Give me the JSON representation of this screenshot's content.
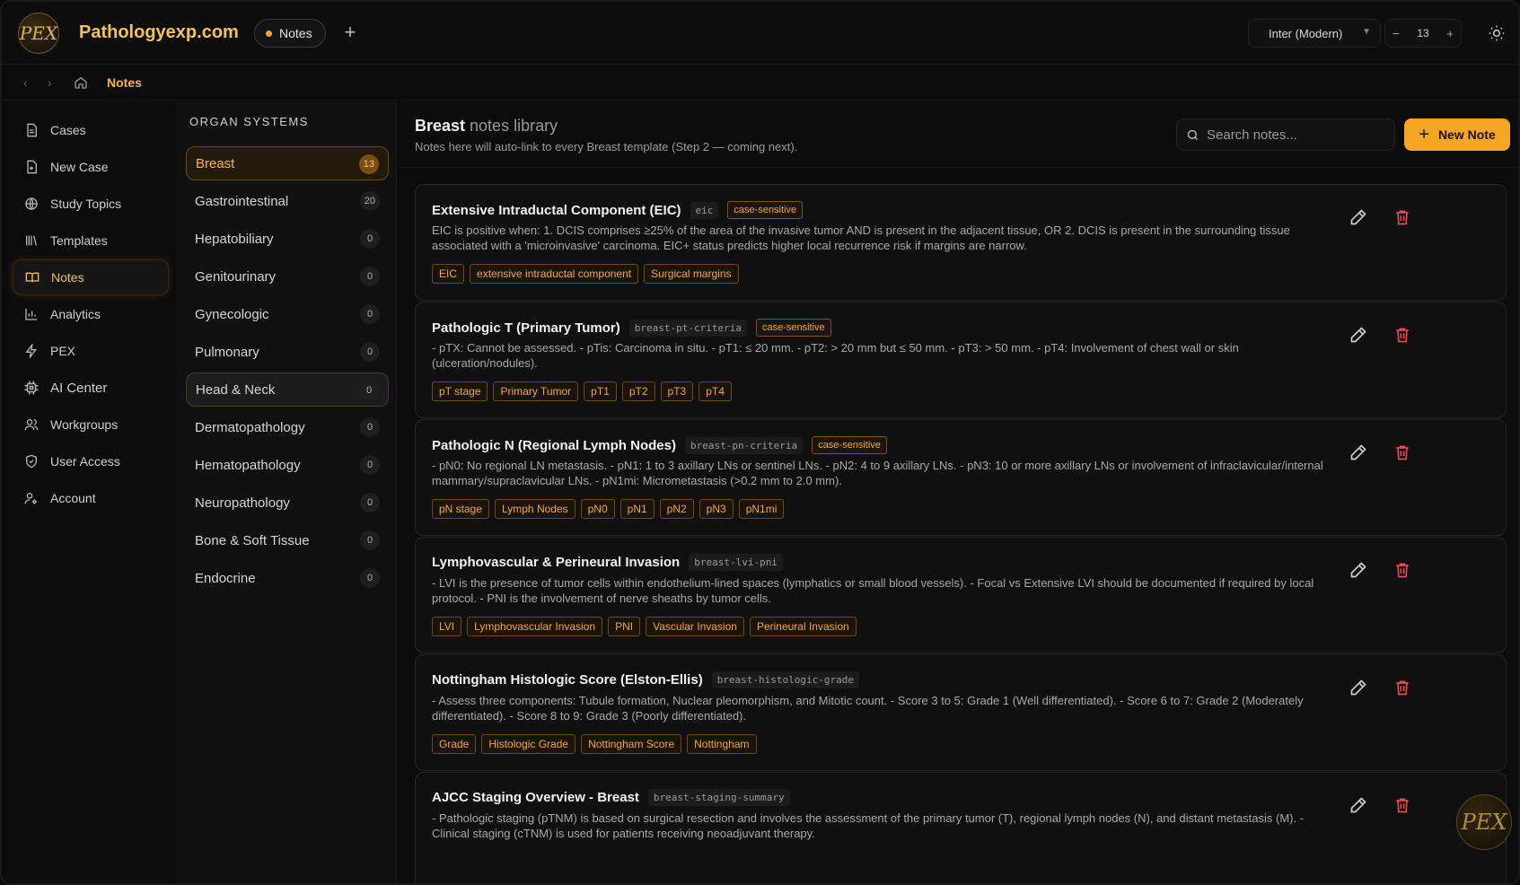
{
  "app": {
    "brand": "Pathologyexp.com",
    "logo_text": "PEX"
  },
  "topbar": {
    "tab_label": "Notes",
    "add_tab": "+",
    "font_select": "Inter (Modern)",
    "font_size": "13",
    "minus": "−",
    "plus": "+"
  },
  "breadcrumb": {
    "current": "Notes"
  },
  "sidebar": {
    "items": [
      {
        "label": "Cases",
        "icon": "document-icon"
      },
      {
        "label": "New Case",
        "icon": "new-document-icon"
      },
      {
        "label": "Study Topics",
        "icon": "globe-icon"
      },
      {
        "label": "Templates",
        "icon": "library-icon"
      },
      {
        "label": "Notes",
        "icon": "book-icon",
        "active": true
      },
      {
        "label": "Analytics",
        "icon": "bar-chart-icon"
      },
      {
        "label": "PEX",
        "icon": "bolt-icon"
      },
      {
        "label": "AI Center",
        "icon": "chip-icon"
      },
      {
        "label": "Workgroups",
        "icon": "users-icon"
      },
      {
        "label": "User Access",
        "icon": "shield-icon"
      },
      {
        "label": "Account",
        "icon": "user-gear-icon"
      }
    ]
  },
  "organs": {
    "title": "ORGAN SYSTEMS",
    "items": [
      {
        "label": "Breast",
        "count": "13"
      },
      {
        "label": "Gastrointestinal",
        "count": "20"
      },
      {
        "label": "Hepatobiliary",
        "count": "0"
      },
      {
        "label": "Genitourinary",
        "count": "0"
      },
      {
        "label": "Gynecologic",
        "count": "0"
      },
      {
        "label": "Pulmonary",
        "count": "0"
      },
      {
        "label": "Head & Neck",
        "count": "0"
      },
      {
        "label": "Dermatopathology",
        "count": "0"
      },
      {
        "label": "Hematopathology",
        "count": "0"
      },
      {
        "label": "Neuropathology",
        "count": "0"
      },
      {
        "label": "Bone & Soft Tissue",
        "count": "0"
      },
      {
        "label": "Endocrine",
        "count": "0"
      }
    ]
  },
  "main": {
    "title_bold": "Breast",
    "title_rest": " notes library",
    "subtitle": "Notes here will auto-link to every Breast template (Step 2 — coming next).",
    "search_placeholder": "Search notes...",
    "new_note": "New Note",
    "notes": [
      {
        "title": "Extensive Intraductal Component (EIC)",
        "slug": "eic",
        "case_sensitive": "case-sensitive",
        "body": "EIC is positive when: 1. DCIS comprises ≥25% of the area of the invasive tumor AND is present in the adjacent tissue, OR 2. DCIS is present in the surrounding tissue associated with a 'microinvasive' carcinoma. EIC+ status predicts higher local recurrence risk if margins are narrow.",
        "tags": [
          "EIC",
          "extensive intraductal component",
          "Surgical margins"
        ]
      },
      {
        "title": "Pathologic T (Primary Tumor)",
        "slug": "breast-pt-criteria",
        "case_sensitive": "case-sensitive",
        "body": "- pTX: Cannot be assessed. - pTis: Carcinoma in situ. - pT1: ≤ 20 mm. - pT2: > 20 mm but ≤ 50 mm. - pT3: > 50 mm. - pT4: Involvement of chest wall or skin (ulceration/nodules).",
        "tags": [
          "pT stage",
          "Primary Tumor",
          "pT1",
          "pT2",
          "pT3",
          "pT4"
        ]
      },
      {
        "title": "Pathologic N (Regional Lymph Nodes)",
        "slug": "breast-pn-criteria",
        "case_sensitive": "case-sensitive",
        "body": "- pN0: No regional LN metastasis. - pN1: 1 to 3 axillary LNs or sentinel LNs. - pN2: 4 to 9 axillary LNs. - pN3: 10 or more axillary LNs or involvement of infraclavicular/internal mammary/supraclavicular LNs. - pN1mi: Micrometastasis (>0.2 mm to 2.0 mm).",
        "tags": [
          "pN stage",
          "Lymph Nodes",
          "pN0",
          "pN1",
          "pN2",
          "pN3",
          "pN1mi"
        ]
      },
      {
        "title": "Lymphovascular & Perineural Invasion",
        "slug": "breast-lvi-pni",
        "case_sensitive": "",
        "body": "- LVI is the presence of tumor cells within endothelium-lined spaces (lymphatics or small blood vessels). - Focal vs Extensive LVI should be documented if required by local protocol. - PNI is the involvement of nerve sheaths by tumor cells.",
        "tags": [
          "LVI",
          "Lymphovascular Invasion",
          "PNI",
          "Vascular Invasion",
          "Perineural Invasion"
        ]
      },
      {
        "title": "Nottingham Histologic Score (Elston-Ellis)",
        "slug": "breast-histologic-grade",
        "case_sensitive": "",
        "body": "- Assess three components: Tubule formation, Nuclear pleomorphism, and Mitotic count. - Score 3 to 5: Grade 1 (Well differentiated). - Score 6 to 7: Grade 2 (Moderately differentiated). - Score 8 to 9: Grade 3 (Poorly differentiated).",
        "tags": [
          "Grade",
          "Histologic Grade",
          "Nottingham Score",
          "Nottingham"
        ]
      },
      {
        "title": "AJCC Staging Overview - Breast",
        "slug": "breast-staging-summary",
        "case_sensitive": "",
        "body": "- Pathologic staging (pTNM) is based on surgical resection and involves the assessment of the primary tumor (T), regional lymph nodes (N), and distant metastasis (M). - Clinical staging (cTNM) is used for patients receiving neoadjuvant therapy.",
        "tags": []
      }
    ]
  },
  "colors": {
    "accent": "#f5a623",
    "danger": "#e5484d",
    "background": "#0b0b0b"
  }
}
